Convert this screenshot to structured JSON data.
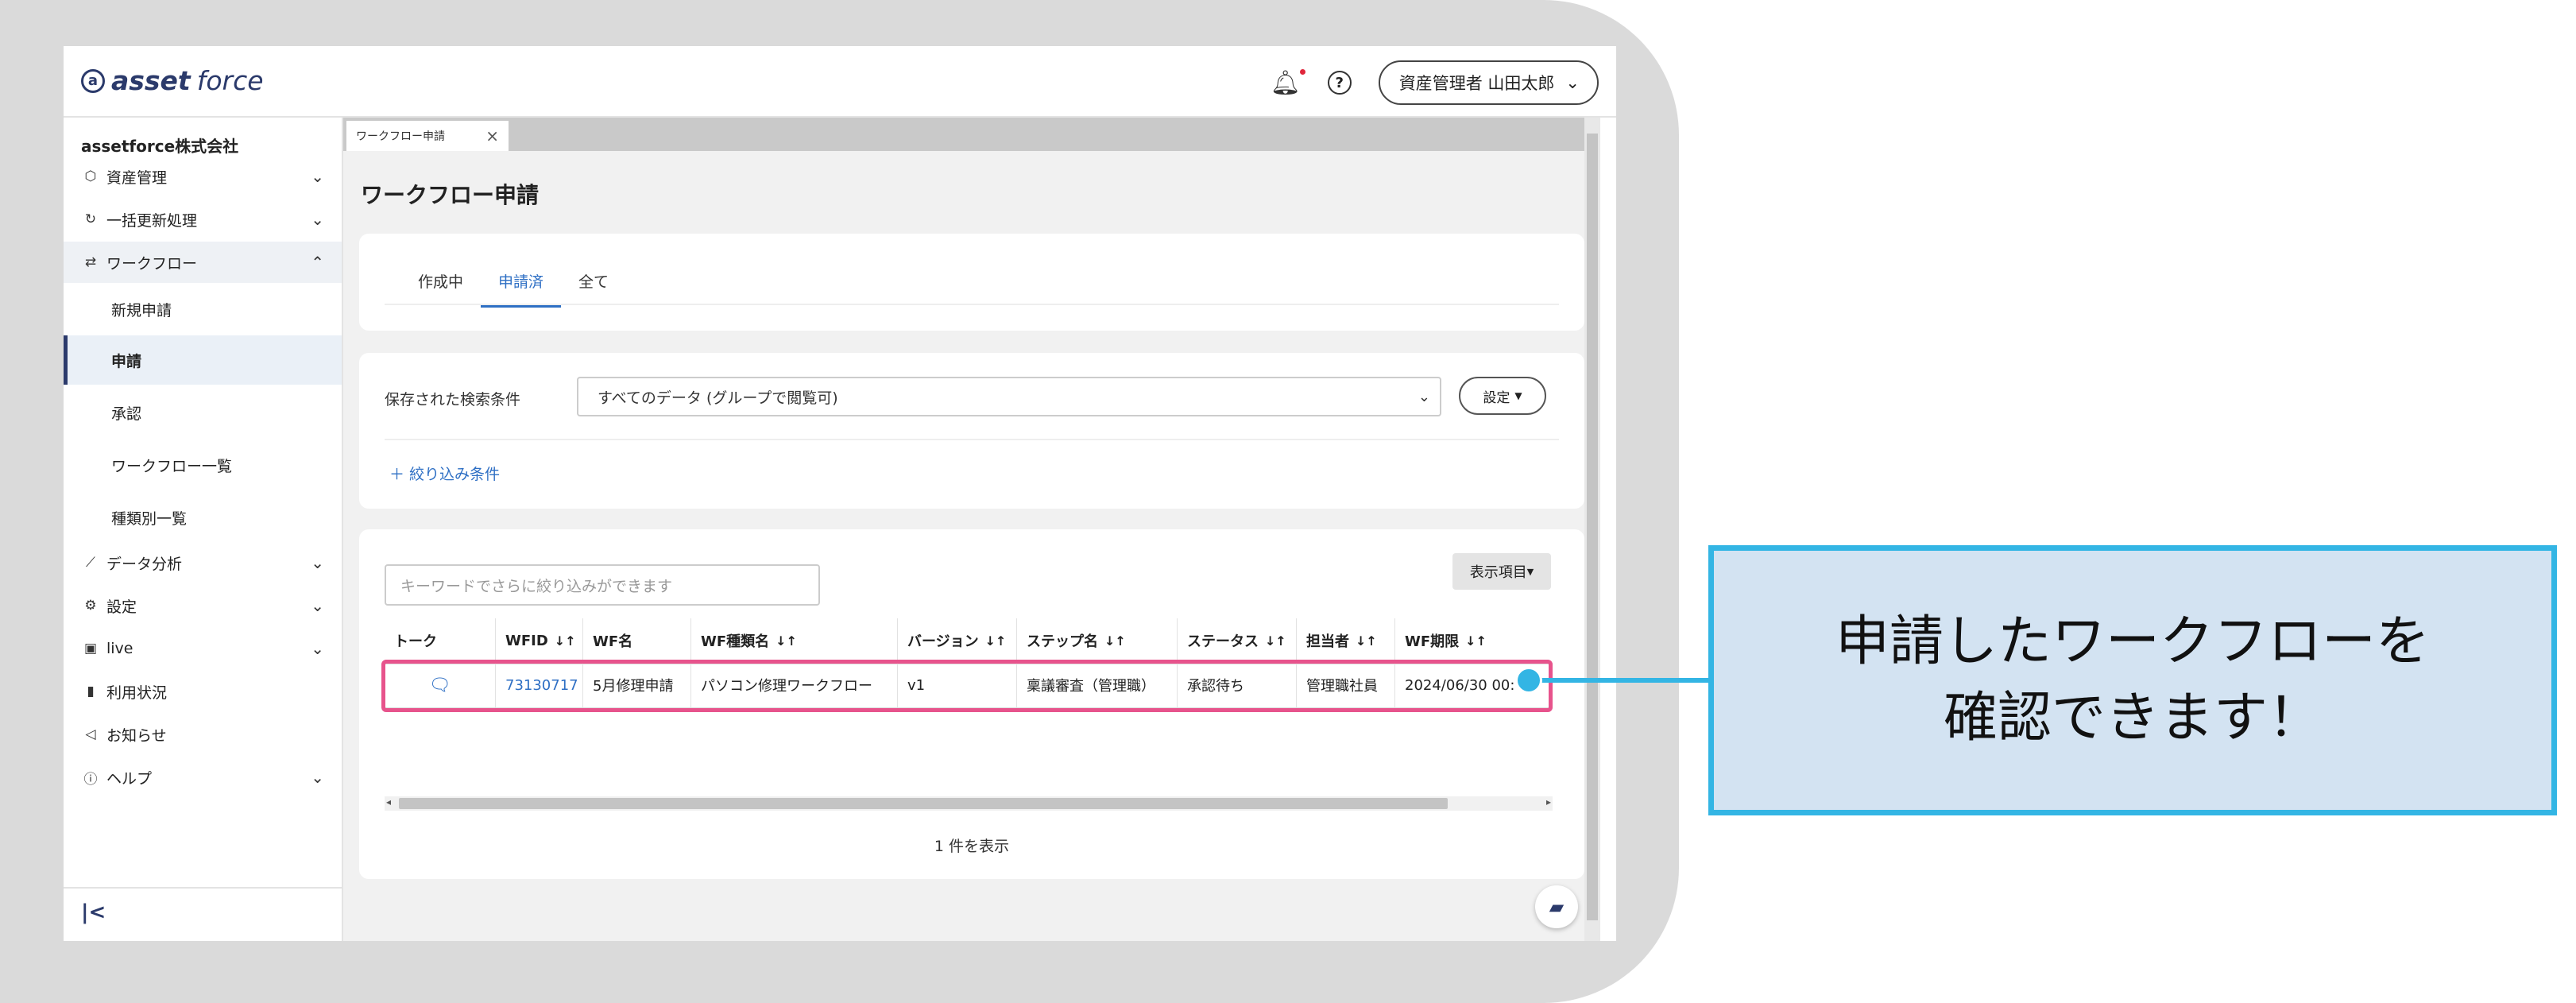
{
  "header": {
    "logo_text_1": "asset",
    "logo_text_2": "force",
    "logo_mark": "a",
    "user_label": "資産管理者 山田太郎"
  },
  "sidebar": {
    "company": "assetforce株式会社",
    "items": [
      {
        "label": "資産管理",
        "icon": "cube-icon"
      },
      {
        "label": "一括更新処理",
        "icon": "refresh-icon"
      },
      {
        "label": "ワークフロー",
        "icon": "workflow-icon"
      },
      {
        "label": "データ分析",
        "icon": "analytics-icon"
      },
      {
        "label": "設定",
        "icon": "gear-icon"
      },
      {
        "label": "live",
        "icon": "live-icon"
      },
      {
        "label": "利用状況",
        "icon": "bar-chart-icon"
      },
      {
        "label": "お知らせ",
        "icon": "megaphone-icon"
      },
      {
        "label": "ヘルプ",
        "icon": "help-icon"
      }
    ],
    "workflow_sub": [
      "新規申請",
      "申請",
      "承認",
      "ワークフロー一覧",
      "種類別一覧"
    ]
  },
  "window_tab": {
    "label": "ワークフロー申請"
  },
  "page": {
    "title": "ワークフロー申請"
  },
  "tabs": [
    "作成中",
    "申請済",
    "全て"
  ],
  "search_conditions": {
    "label": "保存された検索条件",
    "selected": "すべてのデータ (グループで閲覧可)",
    "settings_button": "設定",
    "filter_link": "＋ 絞り込み条件"
  },
  "table": {
    "search_placeholder": "キーワードでさらに絞り込みができます",
    "columns_button": "表示項目",
    "headers": [
      "トーク",
      "WFID",
      "WF名",
      "WF種類名",
      "バージョン",
      "ステップ名",
      "ステータス",
      "担当者",
      "WF期限"
    ],
    "rows": [
      {
        "talk": "",
        "wfid": "73130717",
        "wf_name": "5月修理申請",
        "wf_type": "パソコン修理ワークフロー",
        "version": "v1",
        "step": "稟議審査（管理職）",
        "status": "承認待ち",
        "assignee": "管理職社員",
        "deadline": "2024/06/30 00:"
      }
    ],
    "count_text": "1 件を表示"
  },
  "callout": {
    "line1": "申請したワークフローを",
    "line2": "確認できます！"
  },
  "colors": {
    "accent": "#2e6fc4",
    "brand": "#2b3a6b",
    "highlight": "#e7538c",
    "callout_border": "#33b5e4",
    "callout_bg": "#d3e3f2"
  }
}
